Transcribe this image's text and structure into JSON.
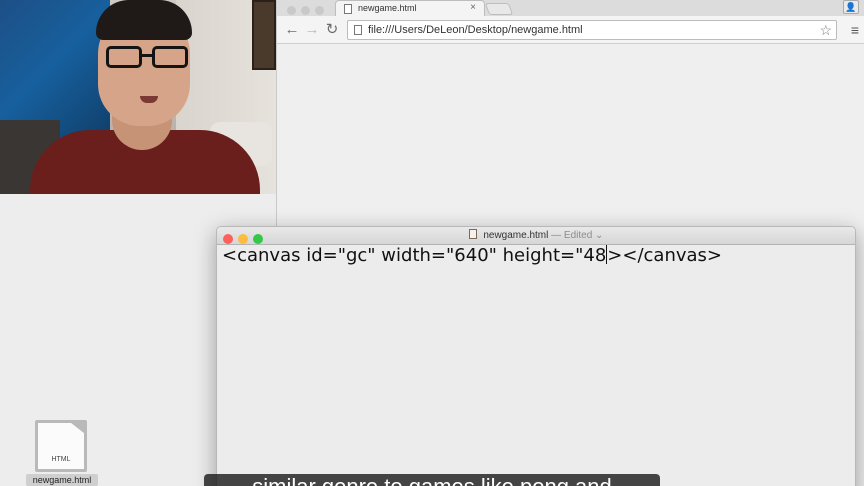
{
  "browser": {
    "tab_title": "newgame.html",
    "tab_close": "×",
    "url": "file:///Users/DeLeon/Desktop/newgame.html",
    "back_icon": "←",
    "forward_icon": "→",
    "reload_icon": "↻",
    "star_icon": "☆",
    "menu_icon": "≡",
    "profile_icon": "👤"
  },
  "editor": {
    "filename": "newgame.html",
    "status": "— Edited ⌄",
    "code_before_caret": "<canvas id=\"gc\" width=\"640\" height=\"48",
    "code_after_caret": "></canvas>",
    "colors": {
      "close": "#fc605c",
      "minimize": "#fdbc40",
      "zoom": "#34c84a"
    }
  },
  "desktop": {
    "file_label": "newgame.html",
    "file_type": "HTML"
  },
  "caption": {
    "text": "similar genre to games like pong and"
  }
}
